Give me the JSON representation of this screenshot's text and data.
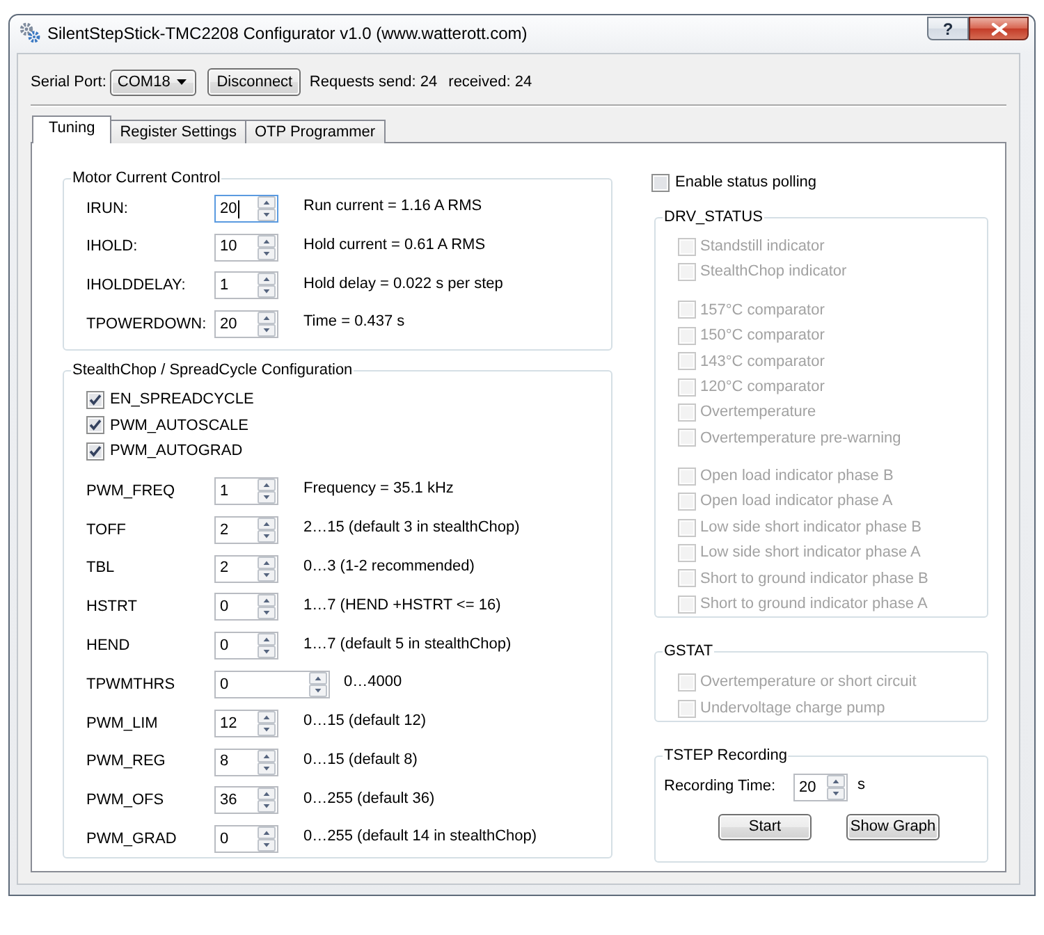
{
  "window": {
    "title": "SilentStepStick-TMC2208 Configurator v1.0 (www.watterott.com)",
    "help_button": "?"
  },
  "connection": {
    "port_label": "Serial Port:",
    "port": "COM18",
    "disconnect_button": "Disconnect",
    "requests_sent": "Requests send: 24",
    "received": "received: 24"
  },
  "tabs": [
    {
      "label": "Tuning",
      "selected": true
    },
    {
      "label": "Register Settings",
      "selected": false
    },
    {
      "label": "OTP Programmer",
      "selected": false
    }
  ],
  "motor_current": {
    "title": "Motor Current Control",
    "rows": [
      {
        "label": "IRUN:",
        "value": "20",
        "focused": true,
        "info": "Run current = 1.16 A RMS"
      },
      {
        "label": "IHOLD:",
        "value": "10",
        "focused": false,
        "info": "Hold current = 0.61 A RMS"
      },
      {
        "label": "IHOLDDELAY:",
        "value": "1",
        "focused": false,
        "info": "Hold delay = 0.022 s per step"
      },
      {
        "label": "TPOWERDOWN:",
        "value": "20",
        "focused": false,
        "info": "Time = 0.437 s"
      }
    ]
  },
  "chopper_config": {
    "title": "StealthChop / SpreadCycle Configuration",
    "options": [
      {
        "label": "EN_SPREADCYCLE",
        "checked": true
      },
      {
        "label": "PWM_AUTOSCALE",
        "checked": true
      },
      {
        "label": "PWM_AUTOGRAD",
        "checked": true
      }
    ],
    "rows": [
      {
        "kind": "spin",
        "label": "PWM_FREQ",
        "value": "1",
        "info": "Frequency = 35.1 kHz"
      },
      {
        "kind": "spin",
        "label": "TOFF",
        "value": "2",
        "info": "2…15 (default 3 in stealthChop)"
      },
      {
        "kind": "spin",
        "label": "TBL",
        "value": "2",
        "info": "0…3 (1-2 recommended)"
      },
      {
        "kind": "spin",
        "label": "HSTRT",
        "value": "0",
        "info": "1…7 (HEND +HSTRT <= 16)"
      },
      {
        "kind": "spin",
        "label": "HEND",
        "value": "0",
        "info": "1…7 (default 5 in stealthChop)"
      },
      {
        "kind": "wide_spin",
        "label": "TPWMTHRS",
        "value": "0",
        "info": "0…4000"
      },
      {
        "kind": "spin",
        "label": "PWM_LIM",
        "value": "12",
        "info": "0…15 (default 12)"
      },
      {
        "kind": "spin",
        "label": "PWM_REG",
        "value": "8",
        "info": "0…15 (default 8)"
      },
      {
        "kind": "spin",
        "label": "PWM_OFS",
        "value": "36",
        "info": "0…255 (default 36)"
      },
      {
        "kind": "spin",
        "label": "PWM_GRAD",
        "value": "0",
        "info": "0…255 (default 14 in stealthChop)"
      }
    ]
  },
  "status_polling": {
    "label": "Enable status polling",
    "checked": false
  },
  "drv_status": {
    "title": "DRV_STATUS",
    "sections": [
      {
        "items": [
          {
            "label": "Standstill indicator",
            "checked": false,
            "disabled": true
          },
          {
            "label": "StealthChop indicator",
            "checked": false,
            "disabled": true
          }
        ]
      },
      {
        "items": [
          {
            "label": "157°C comparator",
            "checked": false,
            "disabled": true
          },
          {
            "label": "150°C comparator",
            "checked": false,
            "disabled": true
          },
          {
            "label": "143°C comparator",
            "checked": false,
            "disabled": true
          },
          {
            "label": "120°C comparator",
            "checked": false,
            "disabled": true
          },
          {
            "label": "Overtemperature",
            "checked": false,
            "disabled": true
          },
          {
            "label": "Overtemperature pre-warning",
            "checked": false,
            "disabled": true
          }
        ]
      },
      {
        "items": [
          {
            "label": "Open load indicator phase B",
            "checked": false,
            "disabled": true
          },
          {
            "label": "Open load indicator phase A",
            "checked": false,
            "disabled": true
          },
          {
            "label": "Low side short indicator phase B",
            "checked": false,
            "disabled": true
          },
          {
            "label": "Low side short indicator phase A",
            "checked": false,
            "disabled": true
          },
          {
            "label": "Short to ground indicator phase B",
            "checked": false,
            "disabled": true
          },
          {
            "label": "Short to ground indicator phase A",
            "checked": false,
            "disabled": true
          }
        ]
      }
    ]
  },
  "gstat": {
    "title": "GSTAT",
    "items": [
      {
        "label": "Overtemperature or short circuit",
        "checked": false,
        "disabled": true
      },
      {
        "label": "Undervoltage charge pump",
        "checked": false,
        "disabled": true
      }
    ]
  },
  "tstep_recording": {
    "title": "TSTEP Recording",
    "time_label": "Recording Time:",
    "time_value": "20",
    "unit": "s",
    "buttons": [
      {
        "label": "Start"
      },
      {
        "label": "Show Graph"
      }
    ]
  }
}
